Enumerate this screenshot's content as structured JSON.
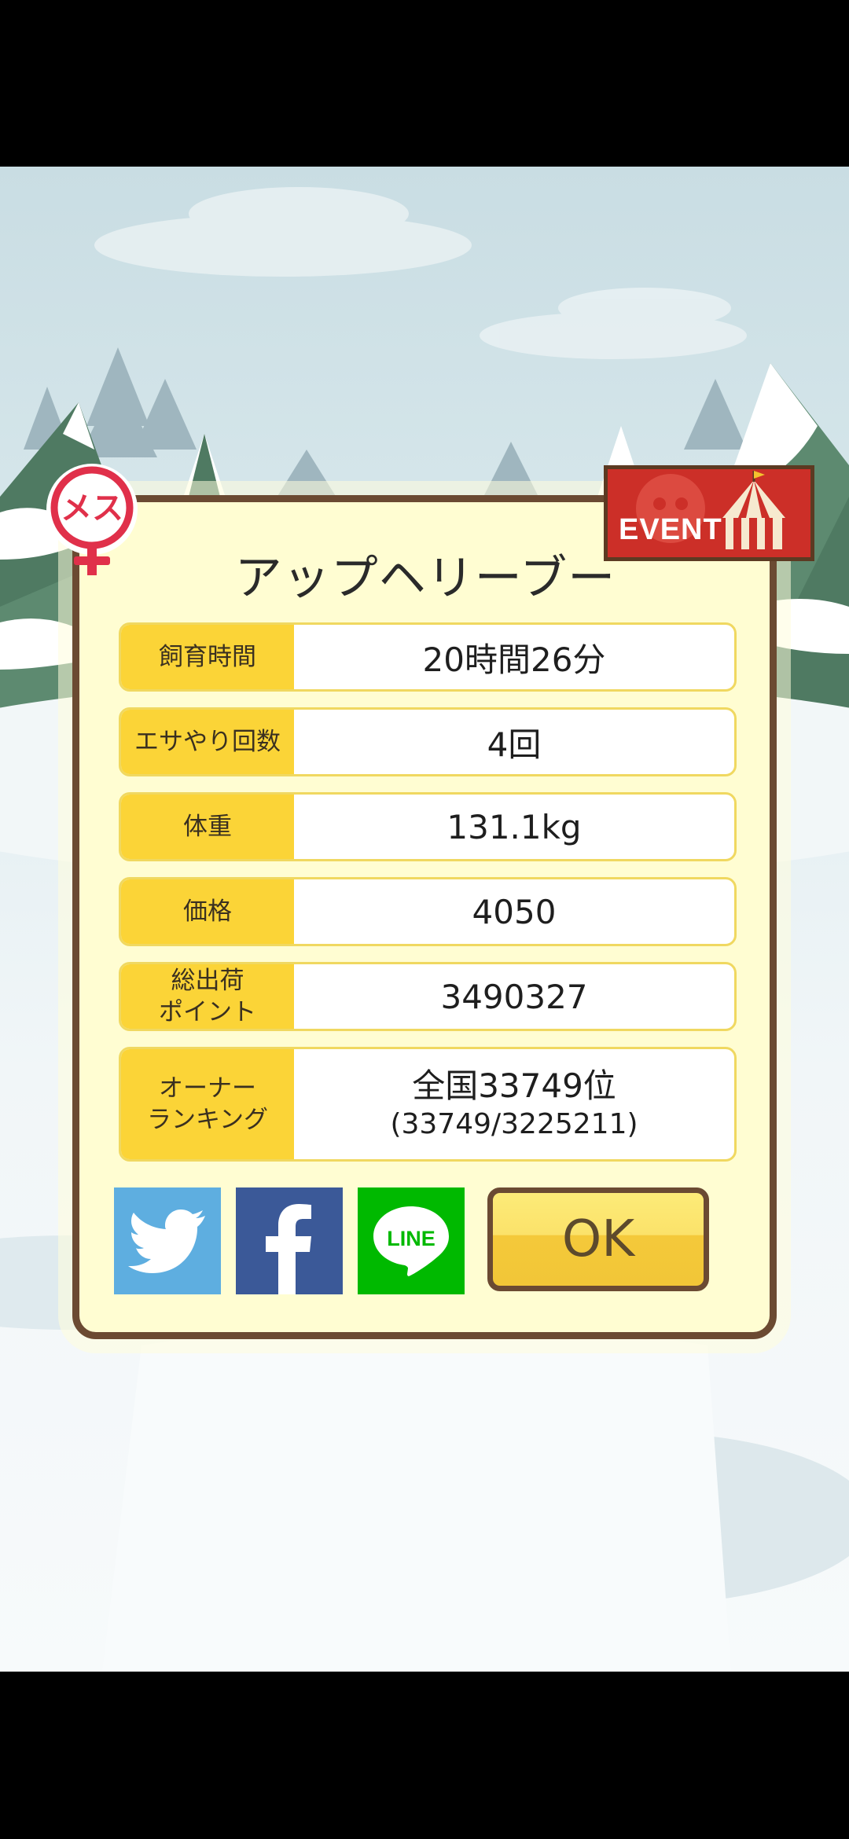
{
  "pig_name": "アップヘリーブー",
  "badges": {
    "sex_label": "メス",
    "event_label": "EVENT"
  },
  "stats": [
    {
      "label": "飼育時間",
      "value": "20時間26分"
    },
    {
      "label": "エサやり回数",
      "value": "4回"
    },
    {
      "label": "体重",
      "value": "131.1kg"
    },
    {
      "label": "価格",
      "value": "4050"
    },
    {
      "label": "総出荷\nポイント",
      "value": "3490327"
    }
  ],
  "ranking": {
    "label": "オーナー\nランキング",
    "value": "全国33749位",
    "detail": "(33749/3225211)"
  },
  "share": {
    "twitter_icon": "twitter-bird-icon",
    "facebook_icon": "facebook-f-icon",
    "line_label": "LINE"
  },
  "ok_label": "OK",
  "colors": {
    "dialog_bg": "#fffdd2",
    "dialog_border": "#6b4a32",
    "label_bg": "#fbd437",
    "twitter": "#55acee",
    "facebook": "#3b5998",
    "line": "#00b900",
    "event_red": "#cc2f28",
    "female_red": "#e0304a"
  }
}
